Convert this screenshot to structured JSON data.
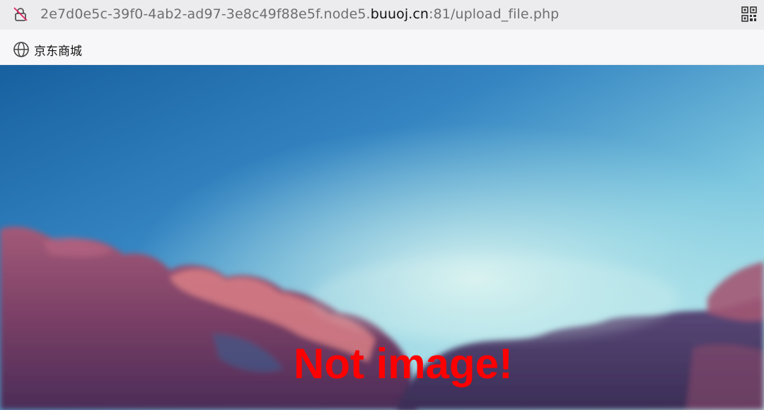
{
  "address_bar": {
    "url_prefix": "2e7d0e5c-39f0-4ab2-ad97-3e8c49f88e5f.node5.",
    "url_domain": "buuoj.cn",
    "url_suffix": ":81/upload_file.php",
    "lock_icon": "insecure-lock-icon",
    "qr_icon": "qr-code-icon"
  },
  "bookmarks": {
    "items": [
      {
        "label": "京东商城",
        "icon": "globe-icon"
      }
    ]
  },
  "page": {
    "message": "Not image!",
    "message_color": "#ff0000",
    "background": "sky-with-clouds"
  }
}
